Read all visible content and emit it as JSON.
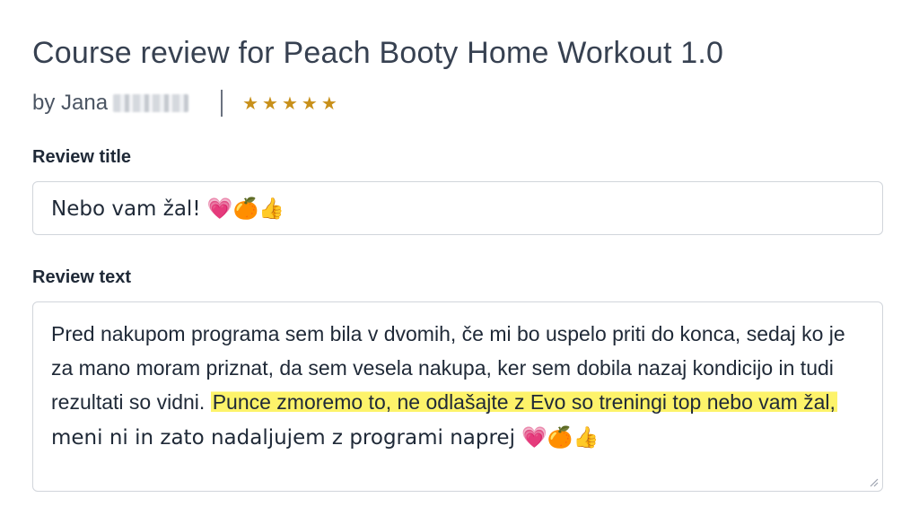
{
  "header": {
    "title": "Course review for Peach Booty Home Workout 1.0",
    "author_prefix": "by Jana",
    "rating": 5,
    "star_color": "#c8901a"
  },
  "form": {
    "review_title_label": "Review title",
    "review_title_value": "Nebo vam žal! 💗🍊👍",
    "review_text_label": "Review text",
    "review_text": {
      "part1": "Pred nakupom programa sem bila v dvomih, če mi bo uspelo priti do konca, sedaj ko je za mano moram priznat, da sem vesela nakupa, ker sem dobila nazaj kondicijo in tudi rezultati so vidni. ",
      "highlight": "Punce zmoremo to, ne odlašajte z Evo so treningi top nebo vam žal,",
      "part2": " meni ni in zato nadaljujem z programi naprej 💗🍊👍"
    },
    "highlight_color": "#fdf36a"
  }
}
